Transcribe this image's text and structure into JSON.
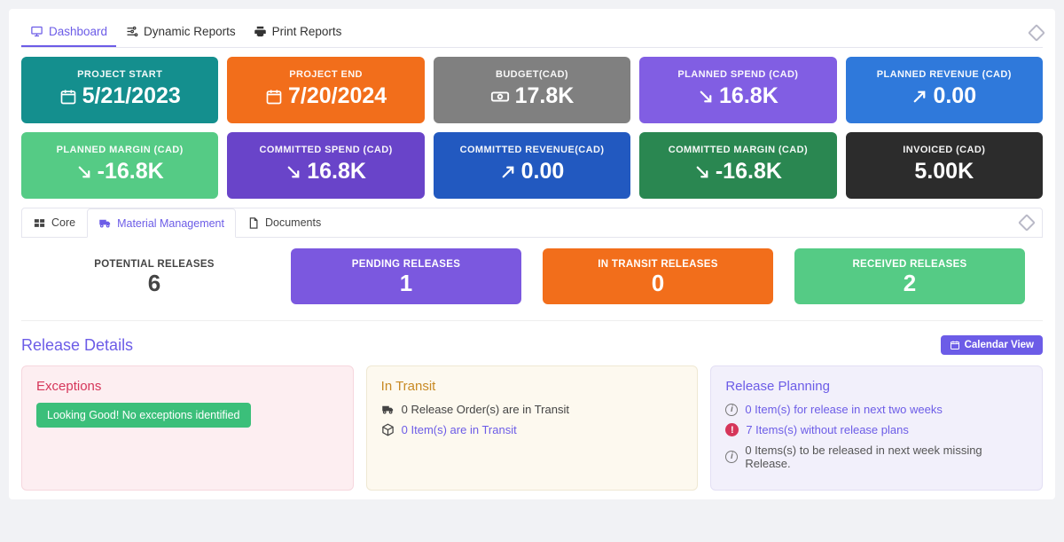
{
  "topTabs": {
    "dashboard": "Dashboard",
    "dynamicReports": "Dynamic Reports",
    "printReports": "Print Reports"
  },
  "stats": [
    {
      "label": "PROJECT START",
      "value": "5/21/2023",
      "icon": "calendar",
      "cls": "c-teal"
    },
    {
      "label": "PROJECT END",
      "value": "7/20/2024",
      "icon": "calendar",
      "cls": "c-orange"
    },
    {
      "label": "BUDGET(CAD)",
      "value": "17.8K",
      "icon": "money",
      "cls": "c-gray"
    },
    {
      "label": "PLANNED SPEND (CAD)",
      "value": "16.8K",
      "icon": "down",
      "cls": "c-purple"
    },
    {
      "label": "PLANNED REVENUE (CAD)",
      "value": "0.00",
      "icon": "up",
      "cls": "c-blue"
    },
    {
      "label": "PLANNED MARGIN (CAD)",
      "value": "-16.8K",
      "icon": "down",
      "cls": "c-green"
    },
    {
      "label": "COMMITTED SPEND (CAD)",
      "value": "16.8K",
      "icon": "down",
      "cls": "c-purple2"
    },
    {
      "label": "COMMITTED REVENUE(CAD)",
      "value": "0.00",
      "icon": "up",
      "cls": "c-blue2"
    },
    {
      "label": "COMMITTED MARGIN (CAD)",
      "value": "-16.8K",
      "icon": "down",
      "cls": "c-dgreen"
    },
    {
      "label": "INVOICED (CAD)",
      "value": "5.00K",
      "icon": "",
      "cls": "c-black"
    }
  ],
  "secTabs": {
    "core": "Core",
    "mm": "Material Management",
    "docs": "Documents"
  },
  "releases": [
    {
      "label": "POTENTIAL RELEASES",
      "value": "6",
      "cls": "rel-gray"
    },
    {
      "label": "PENDING RELEASES",
      "value": "1",
      "cls": "rel-purple"
    },
    {
      "label": "IN TRANSIT RELEASES",
      "value": "0",
      "cls": "rel-orange"
    },
    {
      "label": "RECEIVED RELEASES",
      "value": "2",
      "cls": "rel-green"
    }
  ],
  "rd": {
    "title": "Release Details",
    "calendarBtn": "Calendar View"
  },
  "exceptions": {
    "title": "Exceptions",
    "ok": "Looking Good! No exceptions identified"
  },
  "transit": {
    "title": "In Transit",
    "line1": "0 Release Order(s) are in Transit",
    "line2": "0 Item(s) are in Transit"
  },
  "planning": {
    "title": "Release Planning",
    "l1": "0 Item(s) for release in next two weeks",
    "l2": "7 Items(s) without release plans",
    "l3": "0 Items(s) to be released in next week missing Release."
  }
}
